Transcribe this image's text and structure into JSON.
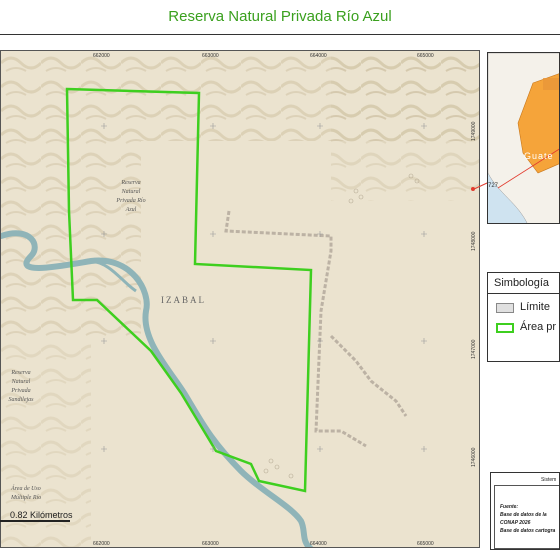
{
  "title": "Reserva Natural Privada Río Azul",
  "x_ticks": [
    "662000",
    "663000",
    "664000",
    "665000"
  ],
  "y_ticks": [
    "1748000",
    "1747000",
    "1746000"
  ],
  "y_tick_right": [
    "1749000",
    "1748000",
    "1747000",
    "1746000"
  ],
  "map_labels": {
    "reserve": [
      "Reserva",
      "Natural",
      "Privada Río",
      "Azul"
    ],
    "region": "IZABAL",
    "other_reserve": [
      "Reserva",
      "Natural",
      "Privada",
      "Sandilejas"
    ],
    "multiuse": [
      "Área de Uso",
      "Múltiple Río"
    ]
  },
  "inset": {
    "label": "Guate",
    "road_label": "727"
  },
  "legend": {
    "title": "Simbología",
    "items": [
      {
        "label": "Límite",
        "fill": "#e0e0e0",
        "stroke": "#888888"
      },
      {
        "label": "Área pr",
        "fill": "#ffffff",
        "stroke": "#3ecf1f"
      }
    ]
  },
  "scale": {
    "label": "0.82 Kilómetros"
  },
  "info": {
    "title": "Sistem",
    "lines": [
      "Fuente:",
      "Base de datos de la",
      "CONAP 2026",
      "Base de datos cartogra"
    ]
  },
  "colors": {
    "boundary": "#3ecf1f",
    "river": "#8fb4b8",
    "terrain": "#e6ddc8",
    "title": "#3aa01e"
  }
}
